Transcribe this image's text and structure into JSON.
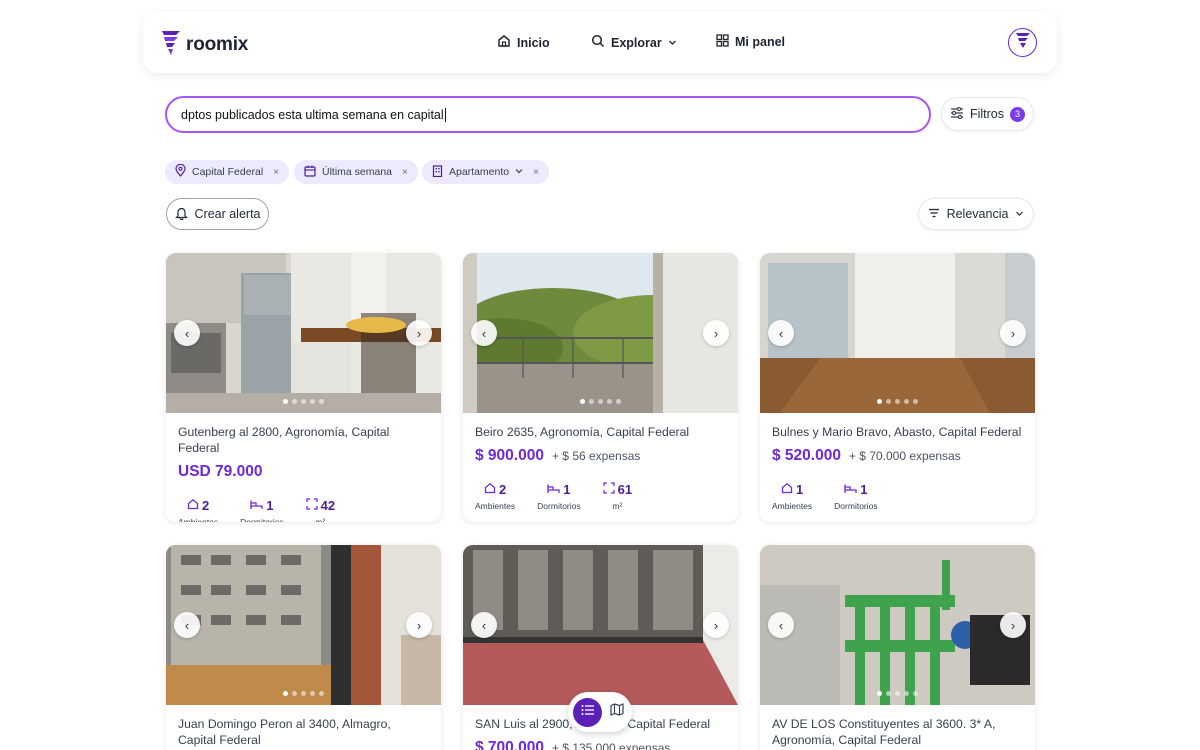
{
  "app": {
    "name": "roomix"
  },
  "nav": {
    "home": "Inicio",
    "explore": "Explorar",
    "panel": "Mi panel"
  },
  "search": {
    "value": "dptos publicados esta ultima semana en capital"
  },
  "filters": {
    "label": "Filtros",
    "count": "3"
  },
  "chips": [
    {
      "label": "Capital Federal",
      "icon": "location-pin-icon"
    },
    {
      "label": "Última semana",
      "icon": "calendar-icon"
    },
    {
      "label": "Apartamento",
      "icon": "building-icon"
    }
  ],
  "actions": {
    "alert": "Crear alerta",
    "sort": "Relevancia"
  },
  "labels": {
    "ambientes": "Ambientes",
    "dormitorios": "Dormitorios",
    "m2": "m²"
  },
  "colors": {
    "accent": "#6d28d9",
    "accent_light": "#ede9fe",
    "search_border": "#a855f7"
  },
  "listings": [
    {
      "address": "Gutenberg al 2800, Agronomía, Capital Federal",
      "price": "USD 79.000",
      "expensas": "",
      "ambientes": "2",
      "dormitorios": "1",
      "m2": "42"
    },
    {
      "address": "Beiro 2635, Agronomía, Capital Federal",
      "price": "$ 900.000",
      "expensas": "+ $ 56 expensas",
      "ambientes": "2",
      "dormitorios": "1",
      "m2": "61"
    },
    {
      "address": "Bulnes y Mario Bravo, Abasto, Capital Federal",
      "price": "$ 520.000",
      "expensas": "+ $ 70.000 expensas",
      "ambientes": "1",
      "dormitorios": "1",
      "m2": ""
    },
    {
      "address": "Juan Domingo Peron al 3400, Almagro, Capital Federal",
      "price": "",
      "expensas": ""
    },
    {
      "address": "SAN Luis al 2900, Almagro, Capital Federal",
      "price": "$ 700.000",
      "expensas": "+ $ 135.000 expensas"
    },
    {
      "address": "AV DE LOS Constituyentes al 3600. 3* A, Agronomía, Capital Federal",
      "price": "",
      "expensas": ""
    }
  ]
}
